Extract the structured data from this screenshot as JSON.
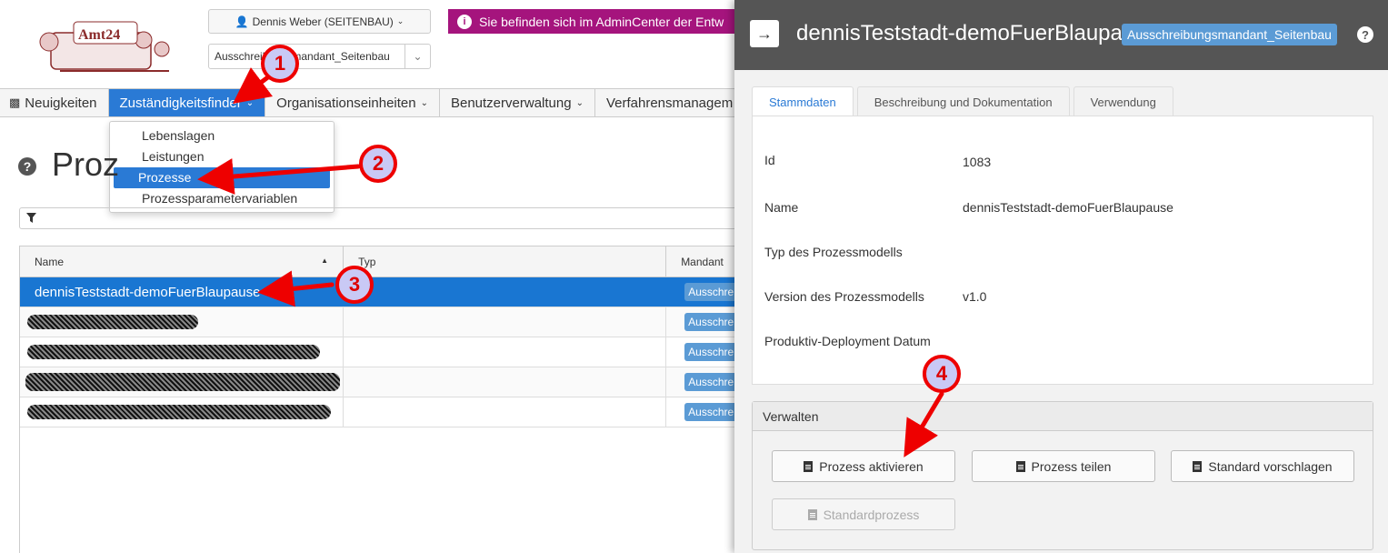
{
  "header": {
    "logo_text": "Amt24",
    "user_button": "Dennis Weber (SEITENBAU)",
    "mandant_select": "Ausschreibungsmandant_Seitenbau",
    "admin_banner": "Sie befinden sich im AdminCenter der Entw"
  },
  "nav": {
    "items": [
      {
        "label": "Neuigkeiten"
      },
      {
        "label": "Zuständigkeitsfinder"
      },
      {
        "label": "Organisationseinheiten"
      },
      {
        "label": "Benutzerverwaltung"
      },
      {
        "label": "Verfahrensmanagem"
      }
    ],
    "dropdown": [
      "Lebenslagen",
      "Leistungen",
      "Prozesse",
      "Prozessparametervariablen"
    ]
  },
  "page": {
    "title": "Proz"
  },
  "grid": {
    "columns": [
      "Name",
      "Typ",
      "Mandant"
    ],
    "first_row_name": "dennisTeststadt-demoFuerBlaupause",
    "mandant_tag": "Ausschre"
  },
  "panel": {
    "title": "dennisTeststadt-demoFuerBlaupause",
    "mandant": "Ausschreibungsmandant_Seitenbau",
    "tabs": [
      "Stammdaten",
      "Beschreibung und Dokumentation",
      "Verwendung"
    ],
    "fields": {
      "id_label": "Id",
      "id_value": "1083",
      "name_label": "Name",
      "name_value": "dennisTeststadt-demoFuerBlaupause",
      "typ_label": "Typ des Prozessmodells",
      "version_label": "Version des Prozessmodells",
      "version_value": "v1.0",
      "deploy_label": "Produktiv-Deployment Datum"
    },
    "verwalten": {
      "title": "Verwalten",
      "aktivieren": "Prozess aktivieren",
      "teilen": "Prozess teilen",
      "standard_vorschlagen": "Standard vorschlagen",
      "standardprozess": "Standardprozess"
    }
  },
  "callouts": [
    "1",
    "2",
    "3",
    "4"
  ],
  "colors": {
    "accent_blue": "#2a7ad5",
    "banner_magenta": "#a5147d",
    "panel_header": "#555555",
    "callout_red": "#ee0000"
  }
}
